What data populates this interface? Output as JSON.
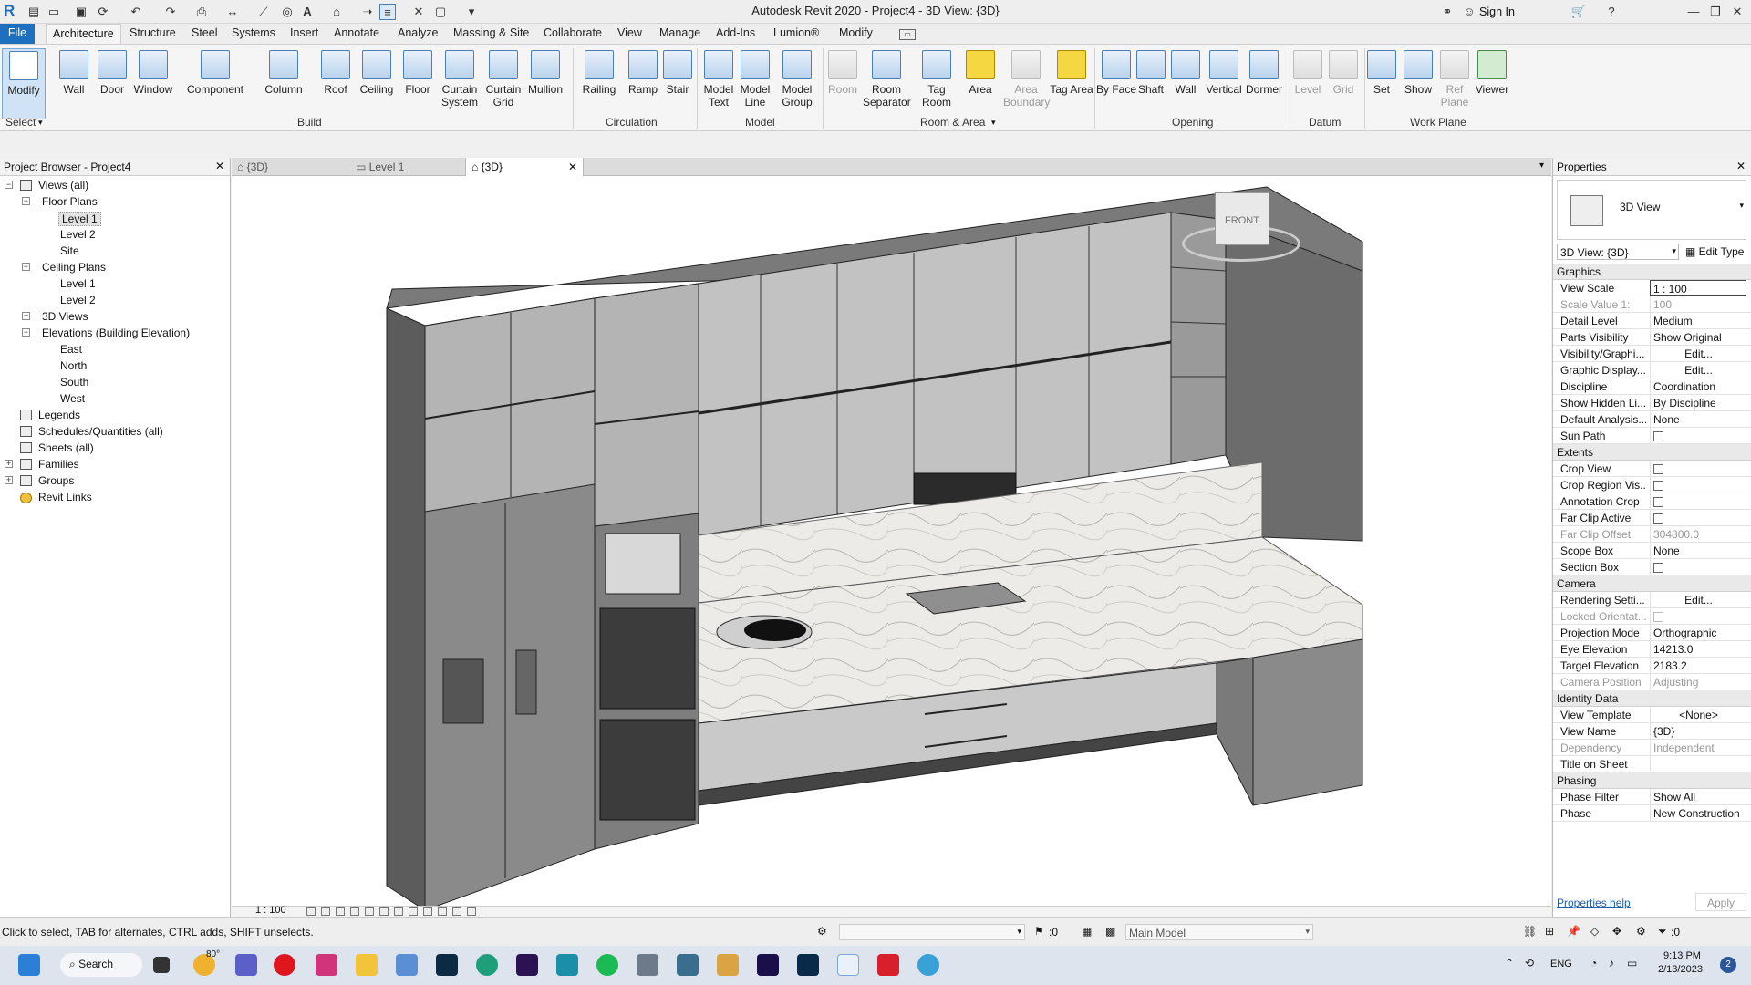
{
  "app": {
    "title": "Autodesk Revit 2020 - Project4 - 3D View: {3D}",
    "sign_in": "Sign In"
  },
  "menu": [
    "File",
    "Architecture",
    "Structure",
    "Steel",
    "Systems",
    "Insert",
    "Annotate",
    "Analyze",
    "Massing & Site",
    "Collaborate",
    "View",
    "Manage",
    "Add-Ins",
    "Lumion®",
    "Modify"
  ],
  "ribbon": {
    "tools": [
      "Modify",
      "Wall",
      "Door",
      "Window",
      "Component",
      "Column",
      "Roof",
      "Ceiling",
      "Floor",
      "Curtain System",
      "Curtain Grid",
      "Mullion",
      "Railing",
      "Ramp",
      "Stair",
      "Model Text",
      "Model Line",
      "Model Group",
      "Room",
      "Room Separator",
      "Tag Room",
      "Area",
      "Area Boundary",
      "Tag Area",
      "By Face",
      "Shaft",
      "Wall",
      "Vertical",
      "Dormer",
      "Level",
      "Grid",
      "Set",
      "Show",
      "Ref Plane",
      "Viewer"
    ],
    "panels": [
      "Select",
      "Build",
      "Circulation",
      "Model",
      "Room & Area",
      "Opening",
      "Datum",
      "Work Plane"
    ]
  },
  "project_browser": {
    "title": "Project Browser - Project4",
    "items": [
      "Views (all)",
      "Floor Plans",
      "Level 1",
      "Level 2",
      "Site",
      "Ceiling Plans",
      "Level 1",
      "Level 2",
      "3D Views",
      "Elevations (Building Elevation)",
      "East",
      "North",
      "South",
      "West",
      "Legends",
      "Schedules/Quantities (all)",
      "Sheets (all)",
      "Families",
      "Groups",
      "Revit Links"
    ]
  },
  "view_tabs": [
    "{3D}",
    "Level 1",
    "{3D}"
  ],
  "viewcube_label": "FRONT",
  "view_bar": {
    "scale": "1 : 100"
  },
  "properties": {
    "title": "Properties",
    "type_name": "3D View",
    "selector": "3D View: {3D}",
    "edit_type": "Edit Type",
    "sections": {
      "graphics": "Graphics",
      "extents": "Extents",
      "camera": "Camera",
      "identity": "Identity Data",
      "phasing": "Phasing"
    },
    "rows": {
      "view_scale": [
        "View Scale",
        "1 : 100"
      ],
      "scale_value": [
        "Scale Value    1:",
        "100"
      ],
      "detail_level": [
        "Detail Level",
        "Medium"
      ],
      "parts_visibility": [
        "Parts Visibility",
        "Show Original"
      ],
      "vis_graphics": [
        "Visibility/Graphi...",
        "Edit..."
      ],
      "graphic_display": [
        "Graphic Display...",
        "Edit..."
      ],
      "discipline": [
        "Discipline",
        "Coordination"
      ],
      "show_hidden": [
        "Show Hidden Li...",
        "By Discipline"
      ],
      "default_analysis": [
        "Default Analysis...",
        "None"
      ],
      "sun_path": [
        "Sun Path",
        ""
      ],
      "crop_view": [
        "Crop View",
        ""
      ],
      "crop_region": [
        "Crop Region Vis...",
        ""
      ],
      "annotation_crop": [
        "Annotation Crop",
        ""
      ],
      "far_clip_active": [
        "Far Clip Active",
        ""
      ],
      "far_clip_offset": [
        "Far Clip Offset",
        "304800.0"
      ],
      "scope_box": [
        "Scope Box",
        "None"
      ],
      "section_box": [
        "Section Box",
        ""
      ],
      "rendering": [
        "Rendering Setti...",
        "Edit..."
      ],
      "locked_orient": [
        "Locked Orientat...",
        ""
      ],
      "projection": [
        "Projection Mode",
        "Orthographic"
      ],
      "eye_elev": [
        "Eye Elevation",
        "14213.0"
      ],
      "target_elev": [
        "Target Elevation",
        "2183.2"
      ],
      "cam_pos": [
        "Camera Position",
        "Adjusting"
      ],
      "view_template": [
        "View Template",
        "<None>"
      ],
      "view_name": [
        "View Name",
        "{3D}"
      ],
      "dependency": [
        "Dependency",
        "Independent"
      ],
      "title_sheet": [
        "Title on Sheet",
        ""
      ],
      "phase_filter": [
        "Phase Filter",
        "Show All"
      ],
      "phase": [
        "Phase",
        "New Construction"
      ]
    },
    "help": "Properties help",
    "apply": "Apply"
  },
  "status": {
    "hint": "Click to select, TAB for alternates, CTRL adds, SHIFT unselects.",
    "count": ":0",
    "model": "Main Model",
    "filter": ":0"
  },
  "taskbar": {
    "search": "Search",
    "weather": "80°",
    "lang": "ENG",
    "time": "9:13 PM",
    "date": "2/13/2023",
    "badge": "2"
  },
  "colors": {
    "accent": "#2b579a",
    "file_tab": "#1f6fbf",
    "marble": "#e6e6e3",
    "cabinet_dark": "#6e6e6e"
  }
}
